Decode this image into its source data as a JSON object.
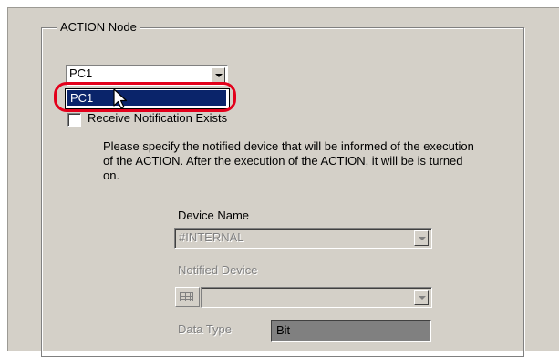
{
  "group": {
    "title": "ACTION Node"
  },
  "node_select": {
    "value": "PC1"
  },
  "dropdown": {
    "items": [
      "PC1"
    ]
  },
  "receive_notification": {
    "label": "Receive Notification Exists",
    "checked": false
  },
  "description": "Please specify the notified device that will be informed of the execution of the ACTION. After the execution of the ACTION, it will be is turned on.",
  "device_name": {
    "label": "Device Name",
    "value": "#INTERNAL"
  },
  "notified_device": {
    "label": "Notified Device",
    "value": ""
  },
  "data_type": {
    "label": "Data Type",
    "value": "Bit"
  },
  "colors": {
    "highlight_ring": "#e3001b",
    "selection": "#0a246a",
    "dialog_bg": "#d4d0c8"
  }
}
